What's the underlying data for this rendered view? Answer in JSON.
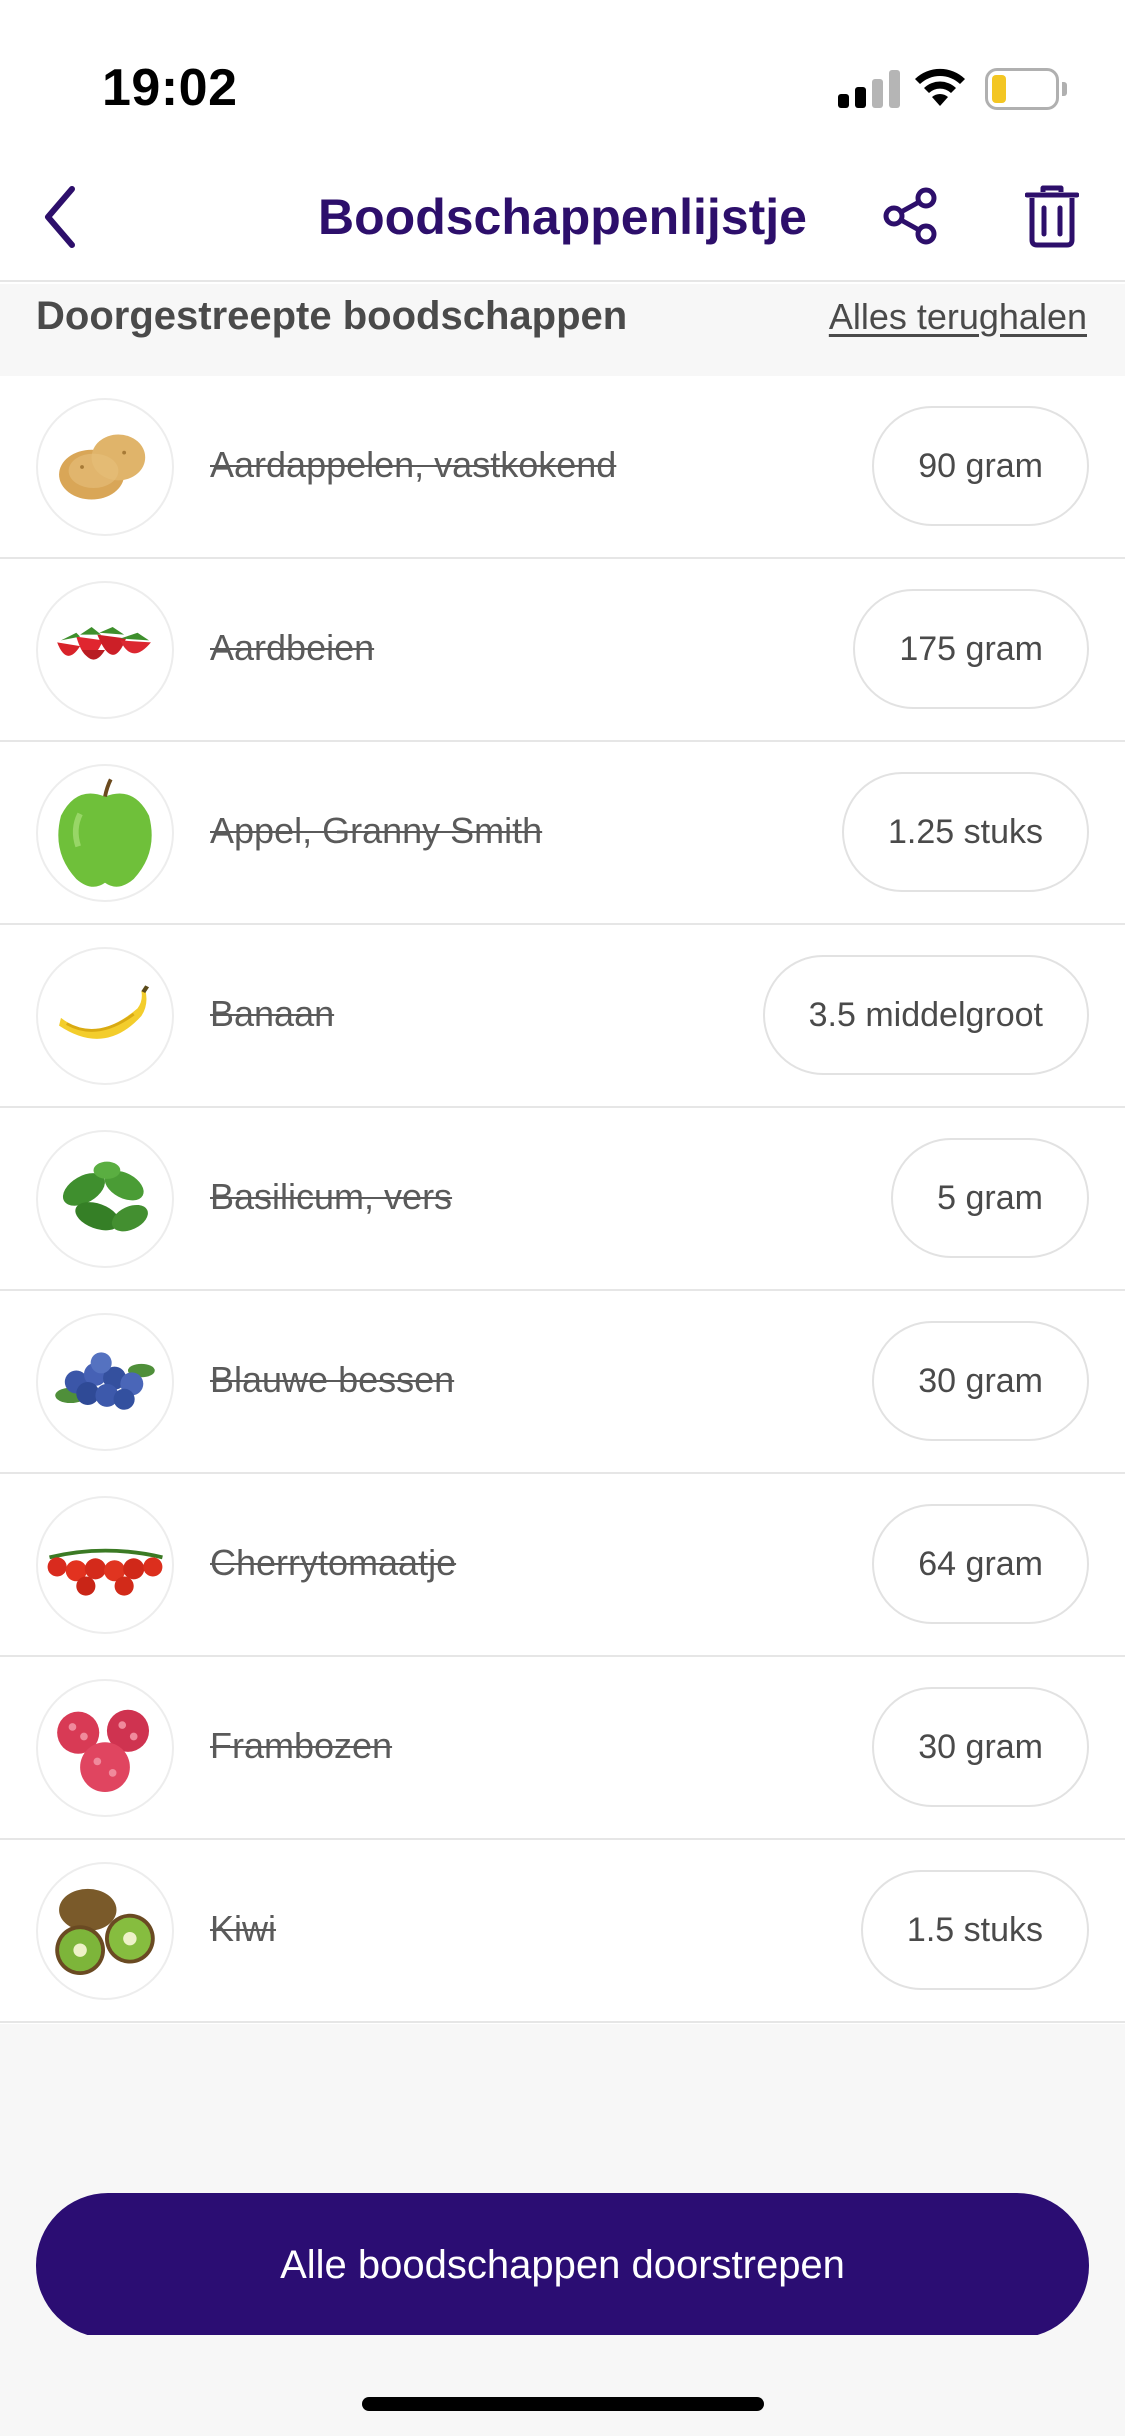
{
  "status_bar": {
    "time": "19:02",
    "icons": [
      "signal-icon",
      "wifi-icon",
      "battery-icon"
    ],
    "battery_color": "#f3c623"
  },
  "nav": {
    "title": "Boodschappenlijstje",
    "back_icon": "chevron-left-icon",
    "share_icon": "share-icon",
    "delete_icon": "trash-icon",
    "accent_color": "#2d0f6b"
  },
  "section": {
    "title": "Doorgestreepte boodschappen",
    "restore_label": "Alles terughalen"
  },
  "items": [
    {
      "name": "Aardappelen, vastkokend",
      "quantity": "90 gram",
      "icon": "potato-icon",
      "checked": true
    },
    {
      "name": "Aardbeien",
      "quantity": "175 gram",
      "icon": "strawberry-icon",
      "checked": true
    },
    {
      "name": "Appel, Granny Smith",
      "quantity": "1.25 stuks",
      "icon": "apple-icon",
      "checked": true
    },
    {
      "name": "Banaan",
      "quantity": "3.5 middelgroot",
      "icon": "banana-icon",
      "checked": true
    },
    {
      "name": "Basilicum, vers",
      "quantity": "5 gram",
      "icon": "basil-icon",
      "checked": true
    },
    {
      "name": "Blauwe bessen",
      "quantity": "30 gram",
      "icon": "blueberry-icon",
      "checked": true
    },
    {
      "name": "Cherrytomaatje",
      "quantity": "64 gram",
      "icon": "tomato-icon",
      "checked": true
    },
    {
      "name": "Frambozen",
      "quantity": "30 gram",
      "icon": "raspberry-icon",
      "checked": true
    },
    {
      "name": "Kiwi",
      "quantity": "1.5 stuks",
      "icon": "kiwi-icon",
      "checked": true
    }
  ],
  "footer": {
    "button_label": "Alle boodschappen doorstrepen",
    "button_color": "#2b0d73"
  }
}
